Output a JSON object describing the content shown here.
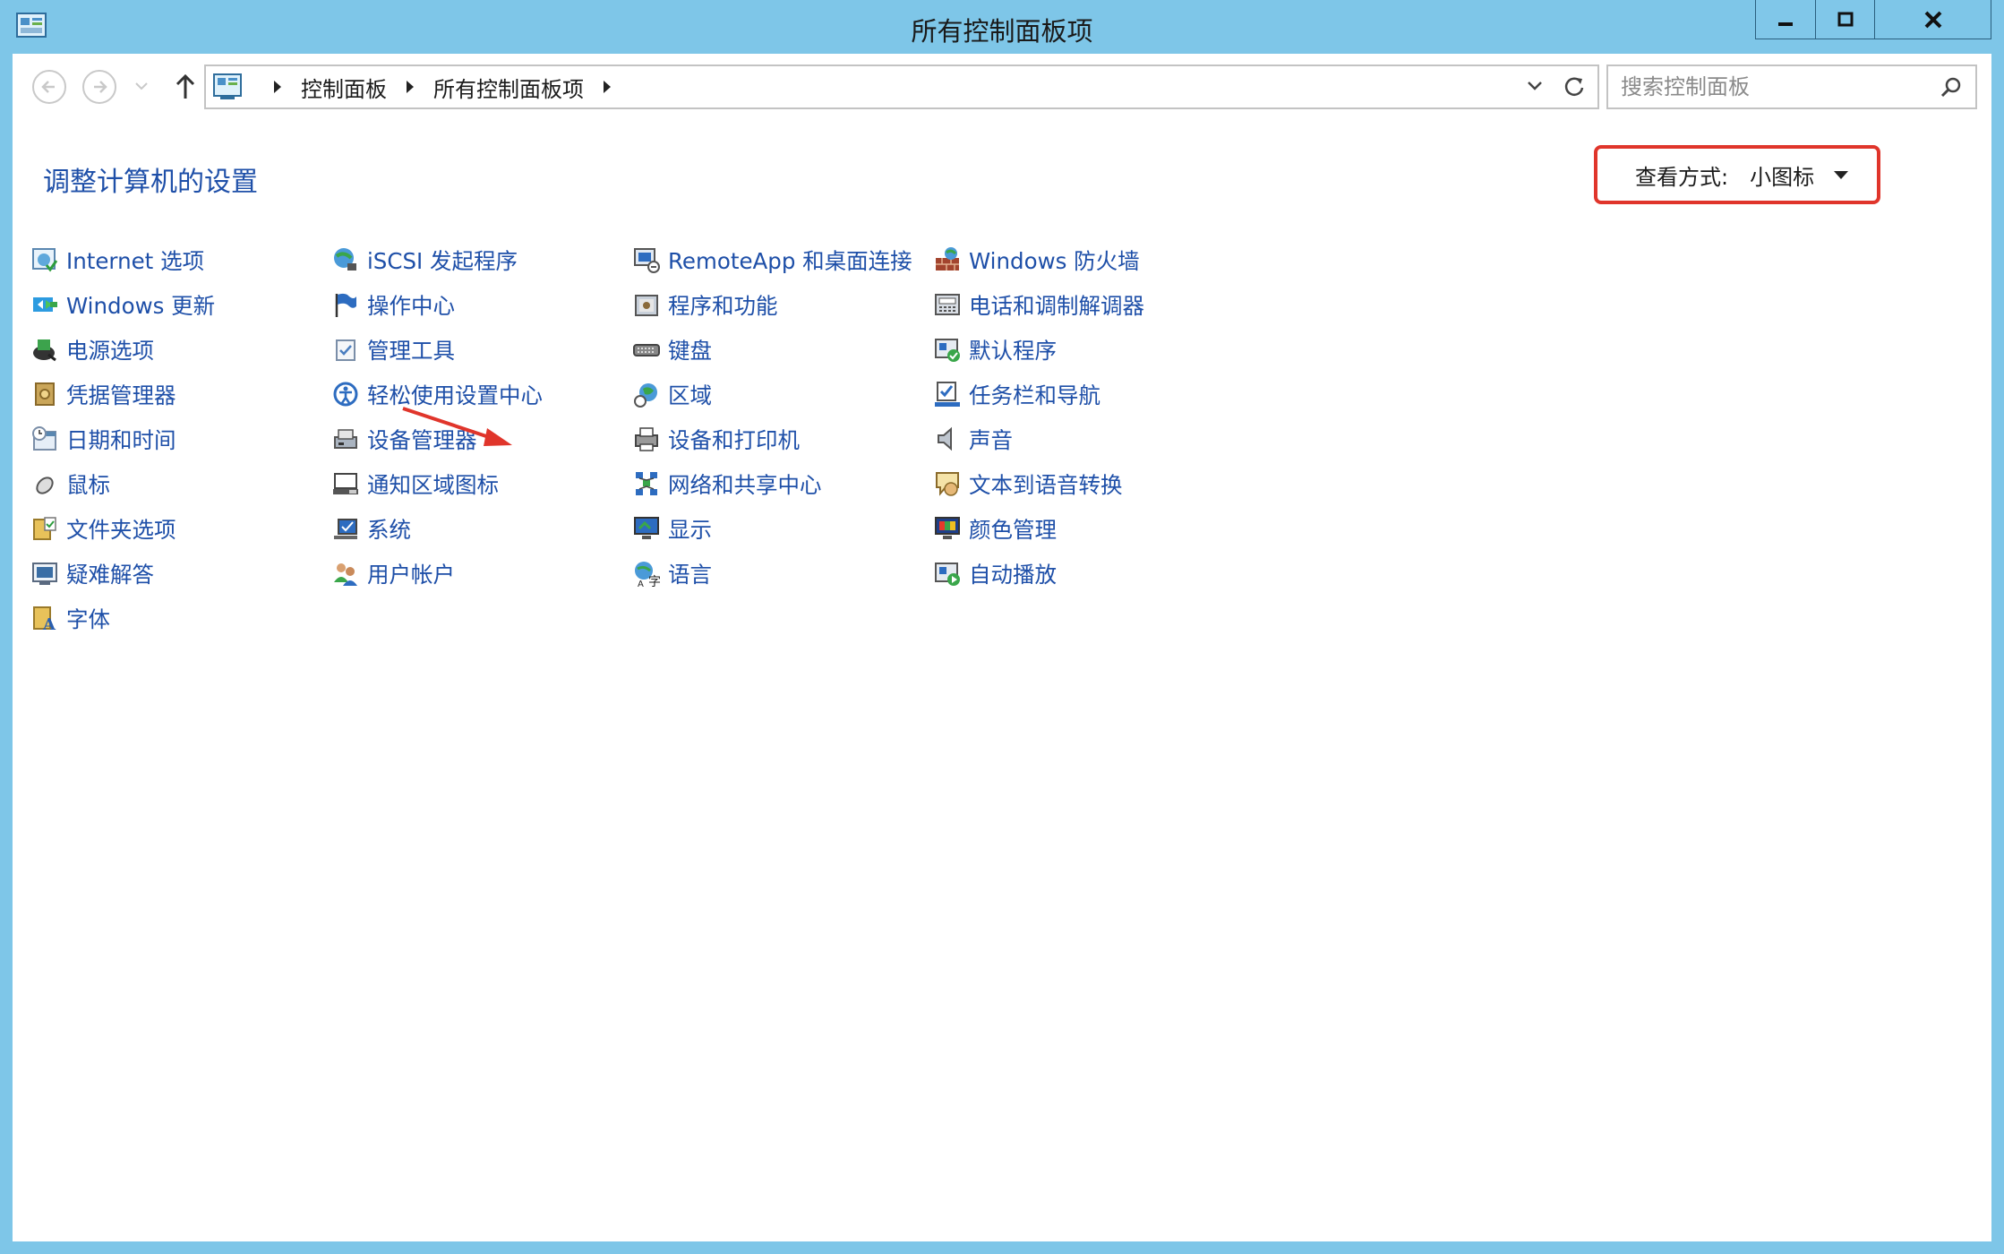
{
  "window": {
    "title": "所有控制面板项"
  },
  "nav": {
    "breadcrumb": [
      "控制面板",
      "所有控制面板项"
    ],
    "search_placeholder": "搜索控制面板"
  },
  "content": {
    "heading": "调整计算机的设置",
    "view_by_label": "查看方式:",
    "view_by_value": "小图标"
  },
  "columns": [
    [
      {
        "label": "Internet 选项",
        "icon": "internet-options-icon"
      },
      {
        "label": "Windows 更新",
        "icon": "windows-update-icon"
      },
      {
        "label": "电源选项",
        "icon": "power-options-icon"
      },
      {
        "label": "凭据管理器",
        "icon": "credential-manager-icon"
      },
      {
        "label": "日期和时间",
        "icon": "date-time-icon"
      },
      {
        "label": "鼠标",
        "icon": "mouse-icon"
      },
      {
        "label": "文件夹选项",
        "icon": "folder-options-icon"
      },
      {
        "label": "疑难解答",
        "icon": "troubleshooting-icon"
      },
      {
        "label": "字体",
        "icon": "fonts-icon"
      }
    ],
    [
      {
        "label": "iSCSI 发起程序",
        "icon": "iscsi-icon"
      },
      {
        "label": "操作中心",
        "icon": "action-center-icon"
      },
      {
        "label": "管理工具",
        "icon": "admin-tools-icon"
      },
      {
        "label": "轻松使用设置中心",
        "icon": "ease-of-access-icon"
      },
      {
        "label": "设备管理器",
        "icon": "device-manager-icon"
      },
      {
        "label": "通知区域图标",
        "icon": "notification-icons-icon"
      },
      {
        "label": "系统",
        "icon": "system-icon"
      },
      {
        "label": "用户帐户",
        "icon": "user-accounts-icon"
      }
    ],
    [
      {
        "label": "RemoteApp 和桌面连接",
        "icon": "remoteapp-icon"
      },
      {
        "label": "程序和功能",
        "icon": "programs-features-icon"
      },
      {
        "label": "键盘",
        "icon": "keyboard-icon"
      },
      {
        "label": "区域",
        "icon": "region-icon"
      },
      {
        "label": "设备和打印机",
        "icon": "devices-printers-icon"
      },
      {
        "label": "网络和共享中心",
        "icon": "network-sharing-icon"
      },
      {
        "label": "显示",
        "icon": "display-icon"
      },
      {
        "label": "语言",
        "icon": "language-icon"
      }
    ],
    [
      {
        "label": "Windows 防火墙",
        "icon": "firewall-icon"
      },
      {
        "label": "电话和调制解调器",
        "icon": "phone-modem-icon"
      },
      {
        "label": "默认程序",
        "icon": "default-programs-icon"
      },
      {
        "label": "任务栏和导航",
        "icon": "taskbar-navigation-icon"
      },
      {
        "label": "声音",
        "icon": "sound-icon"
      },
      {
        "label": "文本到语音转换",
        "icon": "text-to-speech-icon"
      },
      {
        "label": "颜色管理",
        "icon": "color-management-icon"
      },
      {
        "label": "自动播放",
        "icon": "autoplay-icon"
      }
    ]
  ],
  "colors": {
    "accent": "#1e4fa8",
    "titlebar": "#7ec6e8",
    "highlight": "#e0352b"
  }
}
